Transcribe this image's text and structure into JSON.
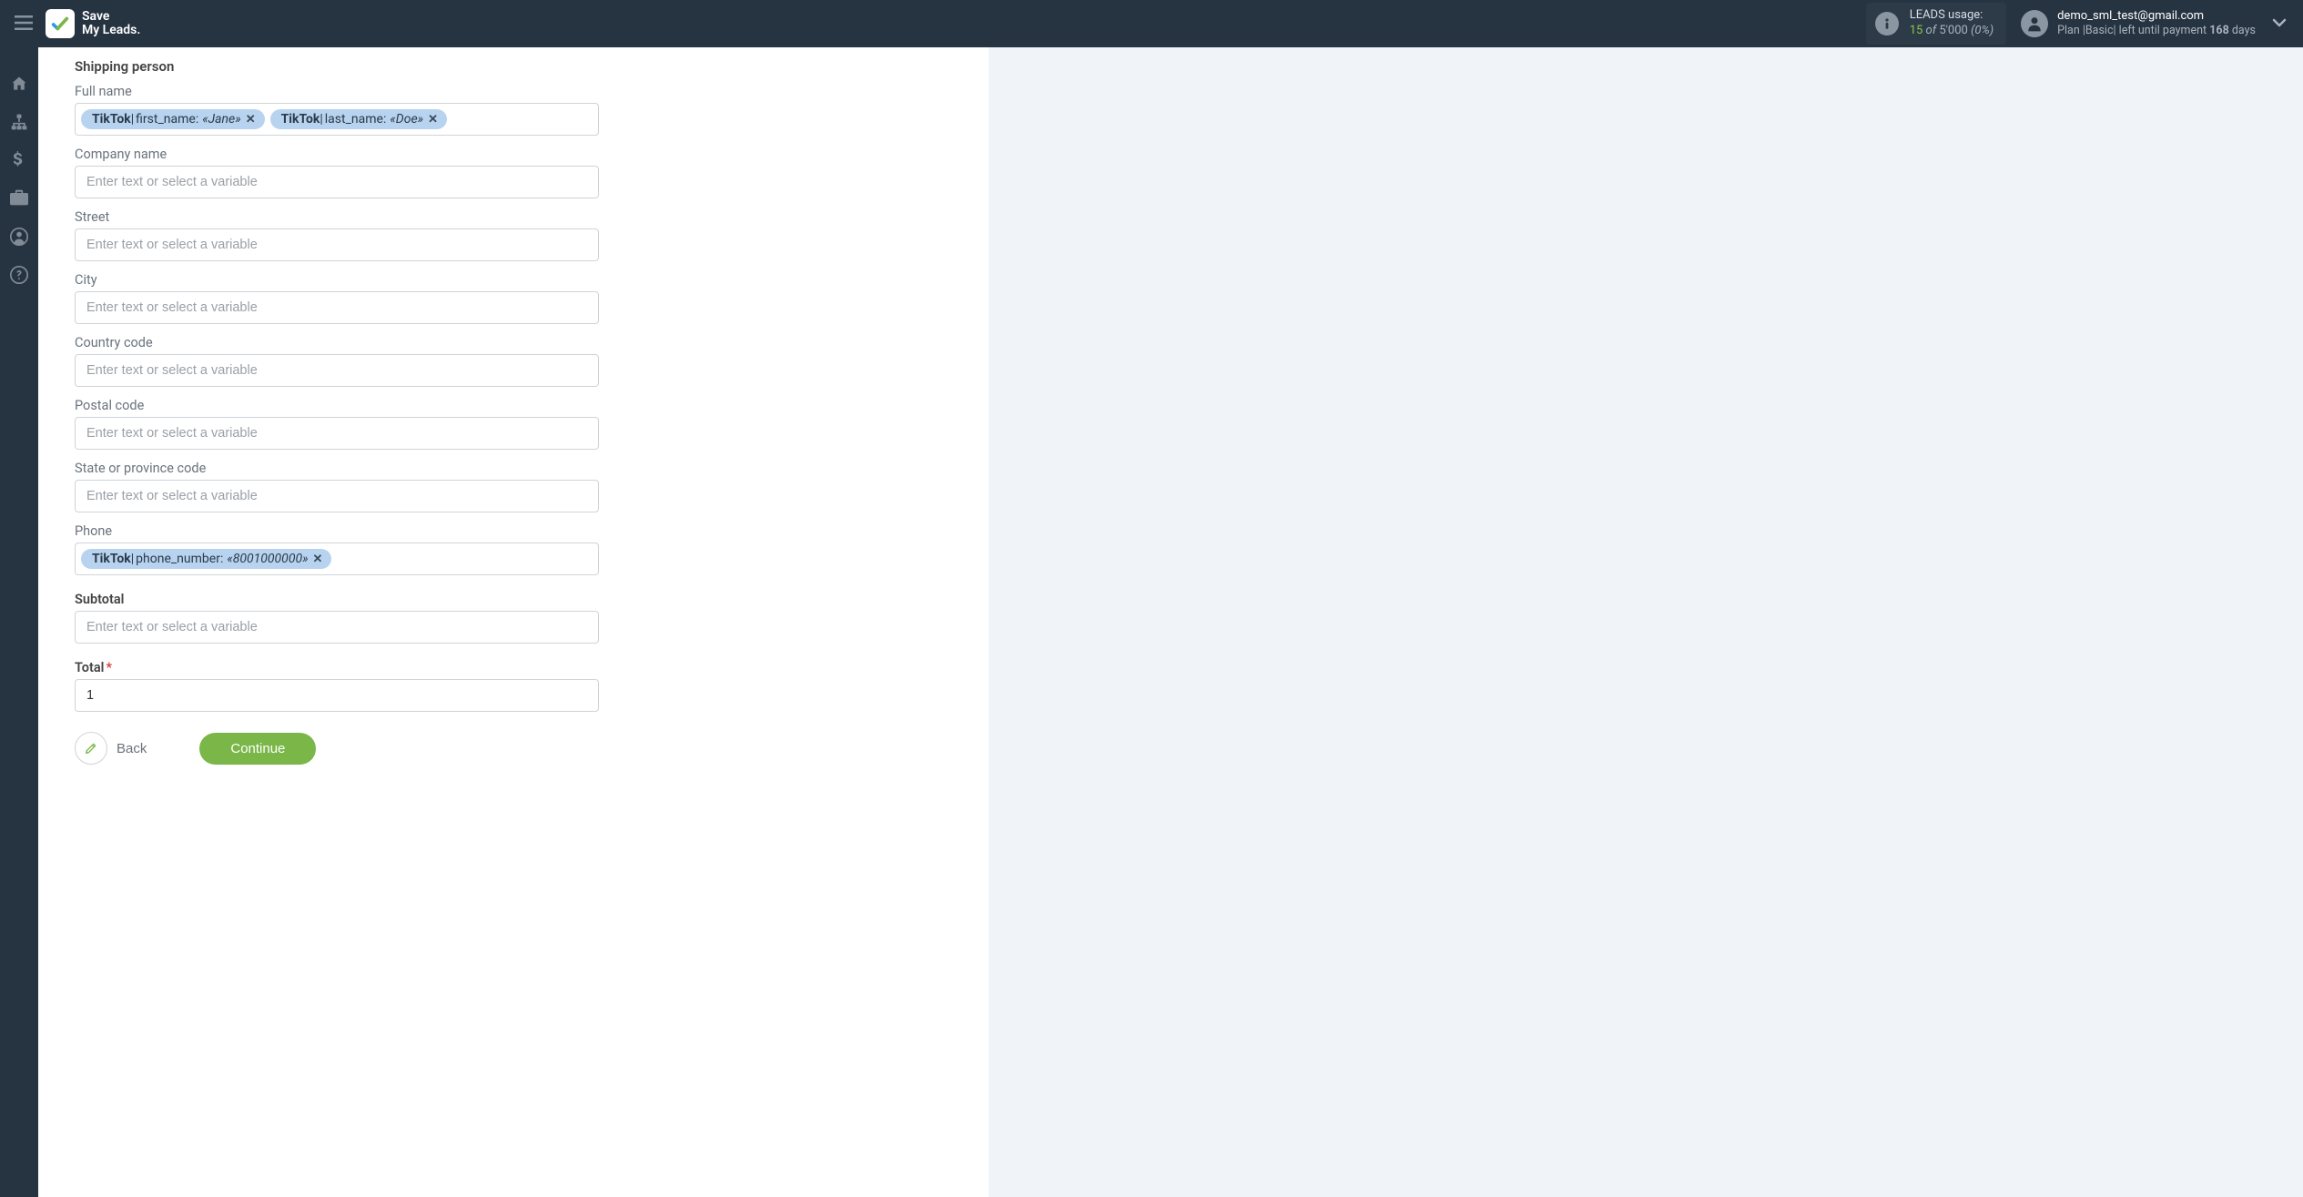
{
  "header": {
    "brand_line1": "Save",
    "brand_line2": "My Leads.",
    "usage_label": "LEADS usage:",
    "usage_current": "15",
    "usage_of_word": "of",
    "usage_total": "5'000",
    "usage_pct": "(0%)",
    "account_email": "demo_sml_test@gmail.com",
    "plan_prefix": "Plan |",
    "plan_name": "Basic",
    "plan_suffix1": "| left until payment ",
    "plan_days": "168",
    "plan_suffix2": " days"
  },
  "sidebar": {
    "icons": [
      "home-icon",
      "sitemap-icon",
      "dollar-icon",
      "briefcase-icon",
      "user-icon",
      "help-icon"
    ]
  },
  "form": {
    "section_title": "Shipping person",
    "placeholder": "Enter text or select a variable",
    "fields": {
      "full_name": {
        "label": "Full name",
        "chips": [
          {
            "source": "TikTok",
            "key": "first_name:",
            "value": "«Jane»"
          },
          {
            "source": "TikTok",
            "key": "last_name:",
            "value": "«Doe»"
          }
        ]
      },
      "company_name": {
        "label": "Company name",
        "chips": []
      },
      "street": {
        "label": "Street",
        "chips": []
      },
      "city": {
        "label": "City",
        "chips": []
      },
      "country_code": {
        "label": "Country code",
        "chips": []
      },
      "postal_code": {
        "label": "Postal code",
        "chips": []
      },
      "state_code": {
        "label": "State or province code",
        "chips": []
      },
      "phone": {
        "label": "Phone",
        "chips": [
          {
            "source": "TikTok",
            "key": "phone_number:",
            "value": "«8001000000»"
          }
        ]
      },
      "subtotal": {
        "label": "Subtotal",
        "chips": [],
        "bold": true
      },
      "total": {
        "label": "Total",
        "required": true,
        "value": "1",
        "bold": true
      }
    },
    "back_label": "Back",
    "continue_label": "Continue"
  }
}
